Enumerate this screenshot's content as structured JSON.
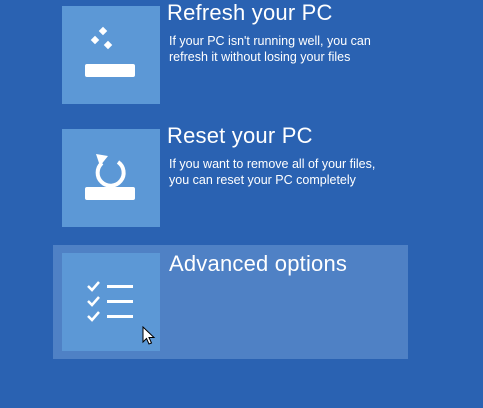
{
  "colors": {
    "background": "#2a62b2",
    "tile": "#5c98d6",
    "selected_highlight": "#4f81c5",
    "text": "#ffffff"
  },
  "options": [
    {
      "title": "Refresh your PC",
      "description": "If your PC isn't running well, you can\nrefresh it without losing your files",
      "icon": "refresh-pc-icon"
    },
    {
      "title": "Reset your PC",
      "description": "If you want to remove all of your files,\nyou can reset your PC completely",
      "icon": "reset-pc-icon"
    },
    {
      "title": "Advanced options",
      "description": "",
      "icon": "advanced-options-icon",
      "selected": true
    }
  ],
  "pointer": {
    "icon": "mouse-pointer-icon"
  }
}
